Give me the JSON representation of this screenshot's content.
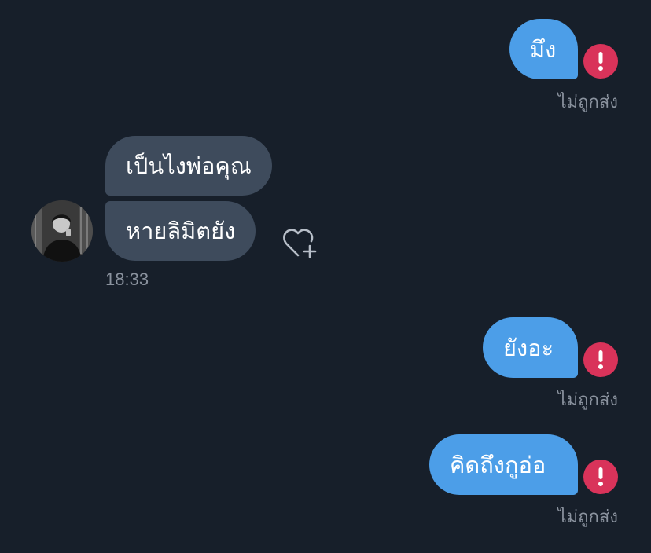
{
  "messages": {
    "outgoing_1": {
      "text": "มึง",
      "status": "ไม่ถูกส่ง"
    },
    "incoming_1": {
      "text": "เป็นไงพ่อคุณ"
    },
    "incoming_2": {
      "text": "หายลิมิตยัง",
      "time": "18:33"
    },
    "outgoing_2": {
      "text": "ยังอะ",
      "status": "ไม่ถูกส่ง"
    },
    "outgoing_3": {
      "text": "คิดถึงกูอ่อ",
      "status": "ไม่ถูกส่ง"
    }
  },
  "icons": {
    "error": "exclamation-circle-icon",
    "react": "heart-plus-icon"
  },
  "colors": {
    "background": "#171f2a",
    "outgoing_bubble": "#4c9ee8",
    "incoming_bubble": "#3e4b5c",
    "error": "#d9335a",
    "muted_text": "#8a929e"
  }
}
